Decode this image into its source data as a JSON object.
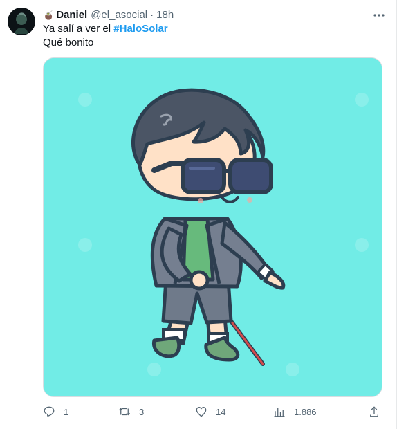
{
  "author": {
    "emoji": "🧉",
    "name": "Daniel",
    "handle": "@el_asocial",
    "separator": "·",
    "time": "18h"
  },
  "tweet": {
    "line1_prefix": "Ya salí a ver el ",
    "hashtag": "#HaloSolar",
    "line2": "Qué bonito"
  },
  "media": {
    "alt": "cartoon boy with sunglasses walking with a white cane",
    "background": "#71ece6"
  },
  "actions": {
    "replies": "1",
    "retweets": "3",
    "likes": "14",
    "views": "1.886"
  },
  "icons": [
    "more-icon",
    "reply-icon",
    "retweet-icon",
    "like-icon",
    "views-icon",
    "share-icon"
  ]
}
